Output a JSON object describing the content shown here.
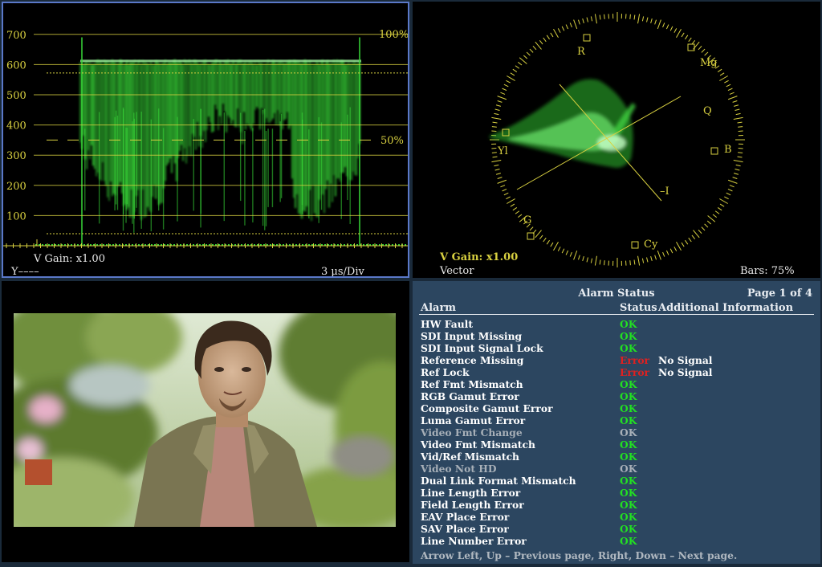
{
  "waveform": {
    "y_labels": [
      "700",
      "600",
      "500",
      "400",
      "300",
      "200",
      "100"
    ],
    "pct_100": "100%",
    "pct_50": "50%",
    "gain": "V Gain: x1.00",
    "channel": "Y––––",
    "timebase": "3 µs/Div",
    "trace_color": "#38d838",
    "grid_color": "#d8d040"
  },
  "vector": {
    "labels": {
      "R": "R",
      "Mg": "Mg",
      "Q": "Q",
      "B": "B",
      "Yl": "Yl",
      "G": "G",
      "Cy": "Cy",
      "I": "–I"
    },
    "gain": "V Gain: x1.00",
    "name": "Vector",
    "bars": "Bars: 75%",
    "color": "#d8d040"
  },
  "alarm_panel": {
    "title": "Alarm Status",
    "page": "Page 1 of 4",
    "col_alarm": "Alarm",
    "col_status": "Status",
    "col_info": "Additional Information",
    "rows": [
      {
        "name": "HW Fault",
        "status": "OK",
        "info": "",
        "state": "ok"
      },
      {
        "name": "SDI Input Missing",
        "status": "OK",
        "info": "",
        "state": "ok"
      },
      {
        "name": "SDI Input Signal Lock",
        "status": "OK",
        "info": "",
        "state": "ok"
      },
      {
        "name": "Reference Missing",
        "status": "Error",
        "info": "No Signal",
        "state": "err"
      },
      {
        "name": "Ref Lock",
        "status": "Error",
        "info": "No Signal",
        "state": "err"
      },
      {
        "name": "Ref Fmt Mismatch",
        "status": "OK",
        "info": "",
        "state": "ok"
      },
      {
        "name": "RGB Gamut Error",
        "status": "OK",
        "info": "",
        "state": "ok"
      },
      {
        "name": "Composite Gamut Error",
        "status": "OK",
        "info": "",
        "state": "ok"
      },
      {
        "name": "Luma Gamut Error",
        "status": "OK",
        "info": "",
        "state": "ok"
      },
      {
        "name": "Video Fmt Change",
        "status": "OK",
        "info": "",
        "state": "dis"
      },
      {
        "name": "Video Fmt Mismatch",
        "status": "OK",
        "info": "",
        "state": "ok"
      },
      {
        "name": "Vid/Ref Mismatch",
        "status": "OK",
        "info": "",
        "state": "ok"
      },
      {
        "name": "Video Not HD",
        "status": "OK",
        "info": "",
        "state": "dis"
      },
      {
        "name": "Dual Link Format Mismatch",
        "status": "OK",
        "info": "",
        "state": "ok"
      },
      {
        "name": "Line Length Error",
        "status": "OK",
        "info": "",
        "state": "ok"
      },
      {
        "name": "Field Length Error",
        "status": "OK",
        "info": "",
        "state": "ok"
      },
      {
        "name": "EAV Place Error",
        "status": "OK",
        "info": "",
        "state": "ok"
      },
      {
        "name": "SAV Place Error",
        "status": "OK",
        "info": "",
        "state": "ok"
      },
      {
        "name": "Line Number Error",
        "status": "OK",
        "info": "",
        "state": "ok"
      }
    ],
    "footer": "Arrow Left, Up – Previous page, Right, Down – Next page."
  }
}
